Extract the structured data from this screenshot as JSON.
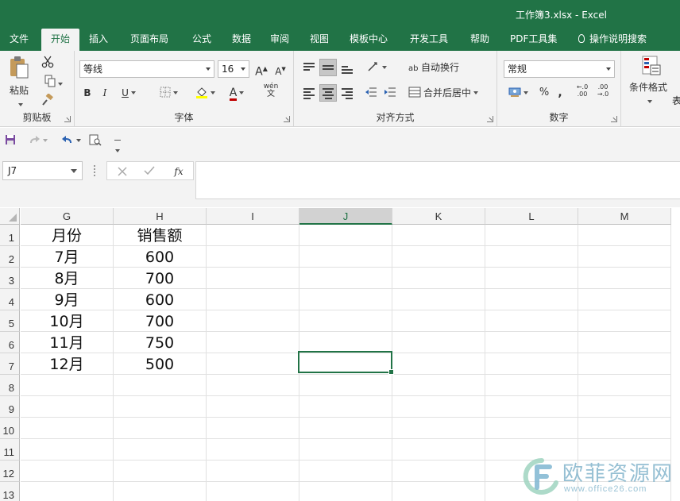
{
  "title": "工作簿3.xlsx  -  Excel",
  "tabs": [
    "文件",
    "开始",
    "插入",
    "页面布局",
    "公式",
    "数据",
    "审阅",
    "视图",
    "模板中心",
    "开发工具",
    "帮助",
    "PDF工具集",
    "操作说明搜索"
  ],
  "active_tab": "开始",
  "ribbon": {
    "clipboard": {
      "label": "剪贴板",
      "paste": "粘贴"
    },
    "font": {
      "label": "字体",
      "name": "等线",
      "size": "16",
      "bold": "B",
      "italic": "I",
      "underline": "U",
      "grow": "A",
      "shrink": "A",
      "phonetic_top": "wén",
      "phonetic_bottom": "文",
      "font_color_glyph": "A",
      "font_color": "#c00000",
      "fill_color": "#ffff00"
    },
    "alignment": {
      "label": "对齐方式",
      "wrap": "自动换行",
      "merge": "合并后居中",
      "wrap_glyph": "ab"
    },
    "number": {
      "label": "数字",
      "format": "常规",
      "percent": "%",
      "comma": ",",
      "inc_decimal_top": "←.0",
      "inc_decimal_bottom": ".00",
      "dec_decimal_top": ".00",
      "dec_decimal_bottom": "→.0"
    },
    "styles": {
      "cond_format": "条件格式",
      "table_cut": "表"
    }
  },
  "formula_bar": {
    "name_box": "J7",
    "fx": "fx",
    "formula": ""
  },
  "columns": [
    "G",
    "H",
    "I",
    "J",
    "K",
    "L",
    "M"
  ],
  "rows": [
    "1",
    "2",
    "3",
    "4",
    "5",
    "6",
    "7",
    "8",
    "9",
    "10",
    "11",
    "12",
    "13"
  ],
  "selected_cell": "J7",
  "cells": [
    [
      "月份",
      "销售额"
    ],
    [
      "7月",
      "600"
    ],
    [
      "8月",
      "700"
    ],
    [
      "9月",
      "600"
    ],
    [
      "10月",
      "700"
    ],
    [
      "11月",
      "750"
    ],
    [
      "12月",
      "500"
    ]
  ],
  "watermark": {
    "text": "欧菲资源网",
    "url": "www.office26.com"
  },
  "colors": {
    "brand": "#217346",
    "header_bg": "#f3f3f3",
    "grid_line": "#e1e1e1"
  }
}
